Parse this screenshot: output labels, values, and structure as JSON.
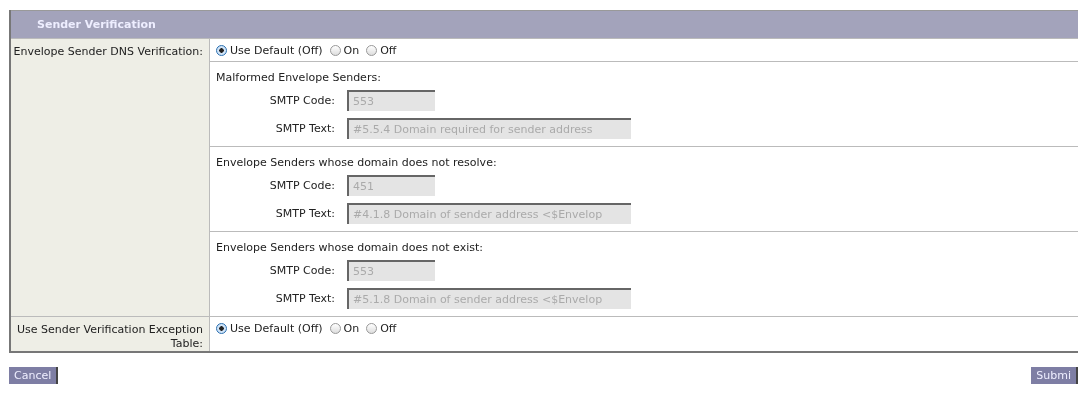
{
  "section_title": "Sender Verification",
  "rows": [
    {
      "label": "Envelope Sender DNS Verification:",
      "options": [
        {
          "label": "Use Default (Off)",
          "selected": true
        },
        {
          "label": "On",
          "selected": false
        },
        {
          "label": "Off",
          "selected": false
        }
      ],
      "groups": [
        {
          "title": "Malformed Envelope Senders:",
          "fields": [
            {
              "label": "SMTP Code:",
              "value": "553",
              "kind": "code",
              "disabled": true
            },
            {
              "label": "SMTP Text:",
              "value": "#5.5.4 Domain required for sender address",
              "kind": "text",
              "disabled": true
            }
          ]
        },
        {
          "title": "Envelope Senders whose domain does not resolve:",
          "fields": [
            {
              "label": "SMTP Code:",
              "value": "451",
              "kind": "code",
              "disabled": true
            },
            {
              "label": "SMTP Text:",
              "value": "#4.1.8 Domain of sender address <$Envelop",
              "kind": "text",
              "disabled": true
            }
          ]
        },
        {
          "title": "Envelope Senders whose domain does not exist:",
          "fields": [
            {
              "label": "SMTP Code:",
              "value": "553",
              "kind": "code",
              "disabled": true
            },
            {
              "label": "SMTP Text:",
              "value": "#5.1.8 Domain of sender address <$Envelop",
              "kind": "text",
              "disabled": true
            }
          ]
        }
      ]
    },
    {
      "label": "Use Sender Verification Exception Table:",
      "options": [
        {
          "label": "Use Default (Off)",
          "selected": true
        },
        {
          "label": "On",
          "selected": false
        },
        {
          "label": "Off",
          "selected": false
        }
      ]
    }
  ],
  "buttons": {
    "cancel": "Cancel",
    "submit": "Submi"
  }
}
